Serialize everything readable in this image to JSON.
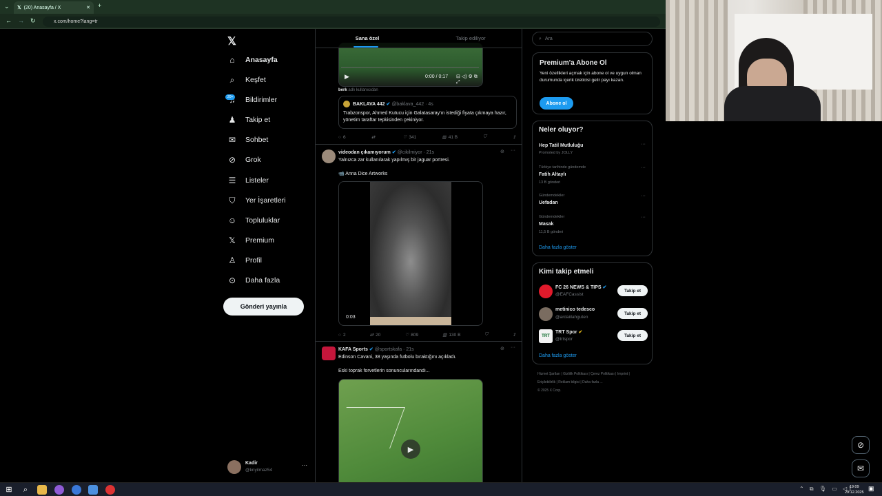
{
  "browser": {
    "tab_title": "(20) Anasayfa / X",
    "url": "x.com/home?lang=tr"
  },
  "nav": {
    "items": [
      {
        "label": "Anasayfa",
        "icon": "home-icon"
      },
      {
        "label": "Keşfet",
        "icon": "search-icon"
      },
      {
        "label": "Bildirimler",
        "icon": "bell-icon"
      },
      {
        "label": "Takip et",
        "icon": "add-person-icon"
      },
      {
        "label": "Sohbet",
        "icon": "mail-icon"
      },
      {
        "label": "Grok",
        "icon": "grok-icon"
      },
      {
        "label": "Listeler",
        "icon": "list-icon"
      },
      {
        "label": "Yer İşaretleri",
        "icon": "bookmark-icon"
      },
      {
        "label": "Topluluklar",
        "icon": "people-icon"
      },
      {
        "label": "Premium",
        "icon": "x-logo-icon"
      },
      {
        "label": "Profil",
        "icon": "person-icon"
      },
      {
        "label": "Daha fazla",
        "icon": "more-circle-icon"
      }
    ],
    "notification_badge": "20+",
    "post_button": "Gönderi yayınla",
    "user": {
      "name": "Kadir",
      "handle": "@knyilmaz54",
      "more": "···"
    }
  },
  "feed": {
    "tabs": [
      "Sana özel",
      "Takip ediliyor"
    ],
    "video_time": "0:00 / 0:17",
    "reposter": {
      "name": "berk",
      "suffix": "adlı kullanıcıdan"
    },
    "quote": {
      "name": "BAKLAVA 442",
      "handle": "@baklava_442 · 4s",
      "text": "Trabzonspor, Ahmed Kutucu için Galatasaray'ın istediği fiyata çıkmaya hazır, yönetim taraftar tepkisinden çekiniyor."
    },
    "actions1": {
      "replies": "6",
      "reposts": "",
      "likes": "341",
      "views": "41 B"
    },
    "tweet2": {
      "name": "videodan çıkamıyorum",
      "handle": "@cikilmiyor · 21s",
      "text": "Yalnızca zar kullanılarak yapılmış bir jaguar portresi.",
      "credit": "📹 Anna Dice Artworks",
      "duration": "0:03",
      "replies": "2",
      "reposts": "20",
      "likes": "809",
      "views": "130 B"
    },
    "tweet3": {
      "name": "KAFA Sports",
      "handle": "@sportskafa · 21s",
      "text": "Edinson Cavani, 38 yaşında futbolu bıraktığını açıkladı.",
      "text2": "Eski toprak forvetlerin sonuncularındandı..."
    }
  },
  "sidebar": {
    "search_placeholder": "Ara",
    "premium": {
      "title": "Premium'a Abone Ol",
      "text": "Yeni özellikleri açmak için abone ol ve uygun olman durumunda içerik üreticisi gelir payı kazan.",
      "button": "Abone ol"
    },
    "trends": {
      "title": "Neler oluyor?",
      "items": [
        {
          "context": "",
          "name": "Hep Tatil Mutluluğu",
          "meta": "Promoted by JOLLY"
        },
        {
          "context": "Türkiye tarihinde gündemde",
          "name": "Fatih Altaylı",
          "meta": "13 B gönderi"
        },
        {
          "context": "Gündemdekiler",
          "name": "Uefadan",
          "meta": ""
        },
        {
          "context": "Gündemdekiler",
          "name": "Masak",
          "meta": "11,5 B gönderi"
        }
      ],
      "more": "Daha fazla göster"
    },
    "who_to_follow": {
      "title": "Kimi takip etmeli",
      "items": [
        {
          "name": "FC 26 NEWS & TIPS",
          "handle": "@EAFCassist",
          "button": "Takip et"
        },
        {
          "name": "metinico tedesco",
          "handle": "@ardaiilahguten",
          "button": "Takip et"
        },
        {
          "name": "TRT Spor",
          "handle": "@trtspor",
          "button": "Takip et"
        }
      ],
      "more": "Daha fazla göster"
    },
    "footer": [
      "Hizmet Şartları",
      "Gizlilik Politikası",
      "Çerez Politikası",
      "Imprint",
      "Erişilebilirlik",
      "Reklam bilgisi",
      "Daha fazla ...",
      "© 2025 X Corp."
    ]
  },
  "taskbar": {
    "time": "19:09",
    "date": "29.12.2025"
  }
}
